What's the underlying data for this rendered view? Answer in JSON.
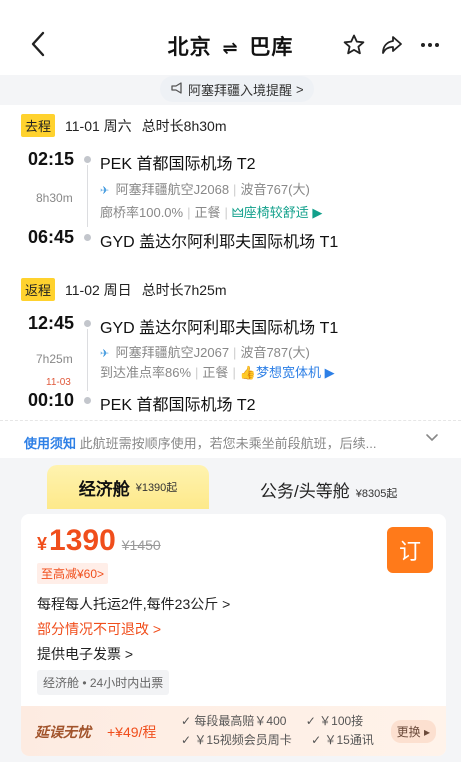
{
  "header": {
    "origin": "北京",
    "arrow": "⇌",
    "destination": "巴库",
    "icons": [
      "back-icon",
      "star-icon",
      "share-icon",
      "more-icon"
    ]
  },
  "notice": {
    "text": "阿塞拜疆入境提醒",
    "suffix": ">"
  },
  "outbound": {
    "tag": "去程",
    "date": "11-01 周六",
    "total": "总时长8h30m",
    "dep_time": "02:15",
    "dep_airport": "PEK 首都国际机场 T2",
    "duration": "8h30m",
    "airline": "阿塞拜疆航空J2068",
    "aircraft": "波音767(大)",
    "bridge_rate": "廊桥率100.0%",
    "meal": "正餐",
    "highlight": "座椅较舒适",
    "arr_time": "06:45",
    "arr_airport": "GYD 盖达尔阿利耶夫国际机场 T1"
  },
  "return": {
    "tag": "返程",
    "date": "11-02 周日",
    "total": "总时长7h25m",
    "dep_time": "12:45",
    "dep_airport": "GYD 盖达尔阿利耶夫国际机场 T1",
    "duration": "7h25m",
    "airline": "阿塞拜疆航空J2067",
    "aircraft": "波音787(大)",
    "ontime_rate": "到达准点率86%",
    "meal": "正餐",
    "highlight": "梦想宽体机",
    "arr_date": "11-03",
    "arr_time": "00:10",
    "arr_airport": "PEK 首都国际机场 T2"
  },
  "rules": {
    "label": "使用须知",
    "text": "此航班需按顺序使用，若您未乘坐前段航班，后续..."
  },
  "cabins": {
    "economy": {
      "name": "经济舱",
      "price": "¥1390起"
    },
    "business": {
      "name": "公务/头等舱",
      "price": "¥8305起"
    }
  },
  "offer": {
    "currency": "¥",
    "price": "1390",
    "original_price": "¥1450",
    "discount": "至高减¥60>",
    "book_label": "订",
    "baggage": "每程每人托运2件,每件23公斤 >",
    "refund": "部分情况不可退改 >",
    "invoice": "提供电子发票 >",
    "cabin_chip": "经济舱 • 24小时内出票"
  },
  "promo": {
    "title": "延误无忧",
    "price": "+¥49/程",
    "items": [
      "每段最高赔￥400",
      "￥100接",
      "￥15视频会员周卡",
      "￥15通讯"
    ],
    "change_label": "更换"
  },
  "colors": {
    "accent": "#f04e1c",
    "tag_yellow": "#ffd22e",
    "link_blue": "#2d7fe6",
    "teal": "#12a08b"
  }
}
